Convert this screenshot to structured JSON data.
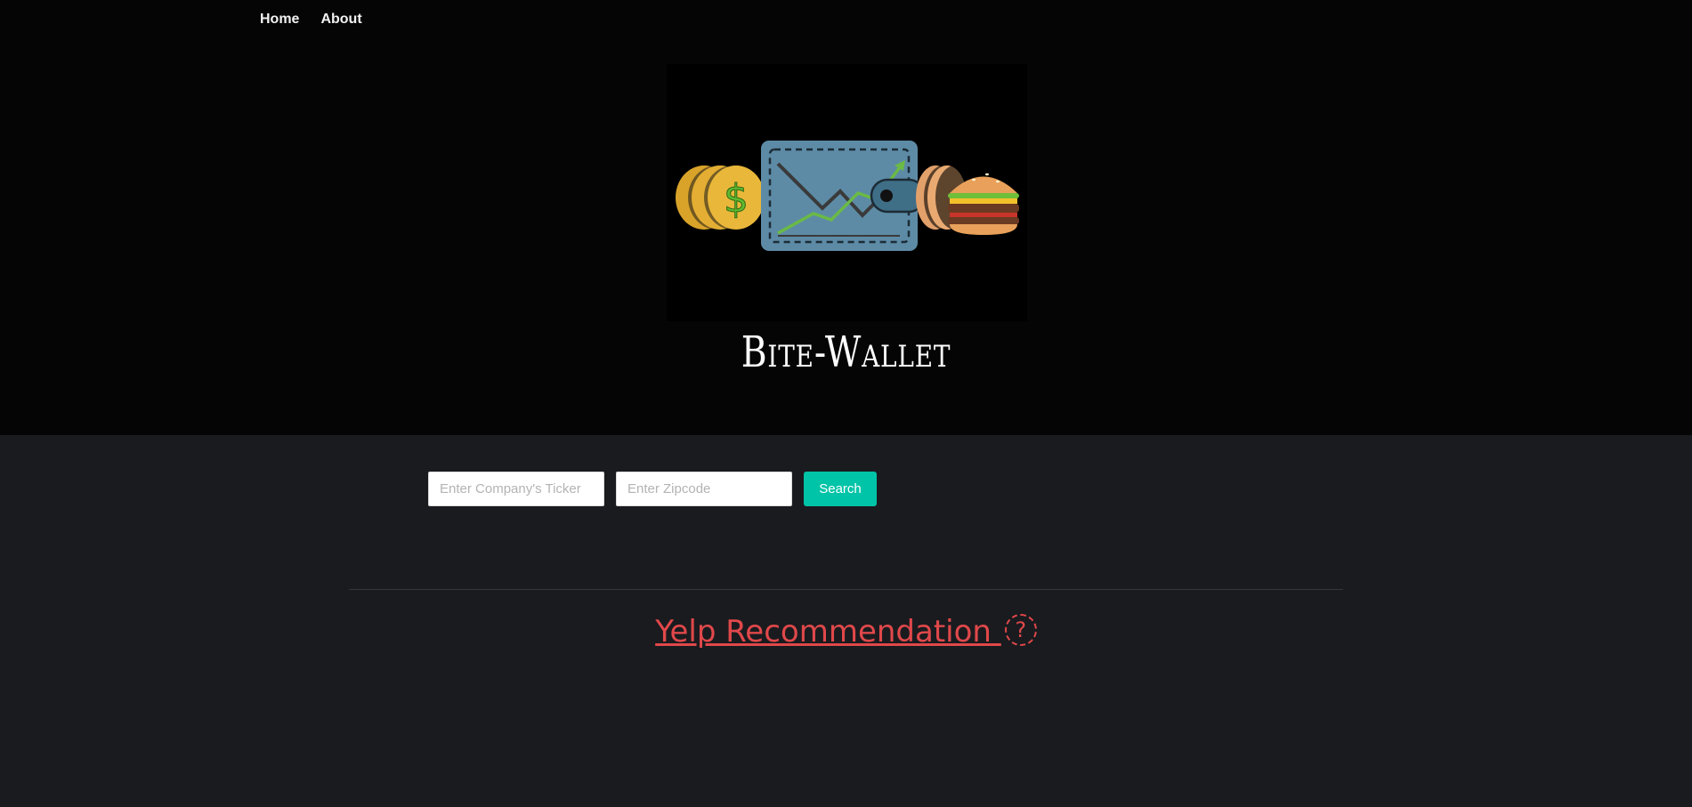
{
  "nav": {
    "home": "Home",
    "about": "About"
  },
  "brand": {
    "title": "Bite-Wallet"
  },
  "search": {
    "ticker_placeholder": "Enter Company's Ticker",
    "ticker_value": "",
    "zip_placeholder": "Enter Zipcode",
    "zip_value": "",
    "button_label": "Search"
  },
  "yelp": {
    "heading": "Yelp Recommendation ",
    "help_glyph": "?"
  },
  "colors": {
    "accent": "#00c4a7",
    "yelp_red": "#e0484a",
    "header_bg": "#050505",
    "body_bg": "#1a1b1f"
  },
  "icons": [
    "coin-dollar-icon",
    "wallet-chart-icon",
    "burger-icon",
    "question-circle-icon"
  ]
}
